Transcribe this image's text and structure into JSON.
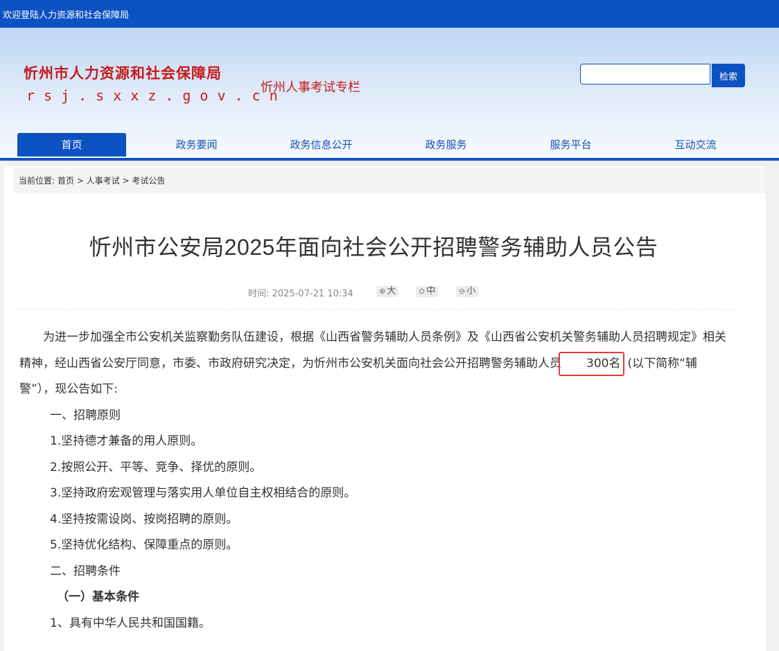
{
  "topbar": {
    "welcome": "欢迎登陆人力资源和社会保障局"
  },
  "header": {
    "logo_cn": "忻州市人力资源和社会保障局",
    "logo_en": "rsj.sxxz.gov.cn",
    "column_title": "忻州人事考试专栏",
    "search": {
      "placeholder": "",
      "button": "检索"
    }
  },
  "nav": [
    {
      "label": "首页",
      "active": true
    },
    {
      "label": "政务要闻"
    },
    {
      "label": "政务信息公开"
    },
    {
      "label": "政务服务"
    },
    {
      "label": "服务平台"
    },
    {
      "label": "互动交流"
    }
  ],
  "breadcrumb": {
    "label": "当前位置:",
    "items": [
      "首页",
      "人事考试",
      "考试公告"
    ],
    "separator": ">"
  },
  "article": {
    "title": "忻州市公安局2025年面向社会公开招聘警务辅助人员公告",
    "meta": {
      "time_label": "时间:",
      "time": "2025-07-21 10:34"
    },
    "font_sizes": [
      "大",
      "中",
      "小"
    ],
    "intro_part1": "为进一步加强全市公安机关监察勤务队伍建设，根据《山西省警务辅助人员条例》及《山西省公安机关警务辅助人员招聘规定》相关精神，经山西省公安厅同意，市委、市政府研究决定，为忻州市公安机关面向社会公开招聘警务辅助人员",
    "intro_highlight": "300名",
    "intro_part2": "(以下简称“辅警”），现公告如下:",
    "lines": [
      "一、招聘原则",
      "1.坚持德才兼备的用人原则。",
      "2.按照公开、平等、竞争、择优的原则。",
      "3.坚持政府宏观管理与落实用人单位自主权相结合的原则。",
      "4.坚持按需设岗、按岗招聘的原则。",
      "5.坚持优化结构、保障重点的原则。",
      "二、招聘条件"
    ],
    "subhead": "（一）基本条件",
    "item1": "1、具有中华人民共和国国籍。"
  },
  "colors": {
    "brand": "#0c52c2",
    "logo_red": "#c61a1a",
    "highlight_border": "#e53935"
  }
}
